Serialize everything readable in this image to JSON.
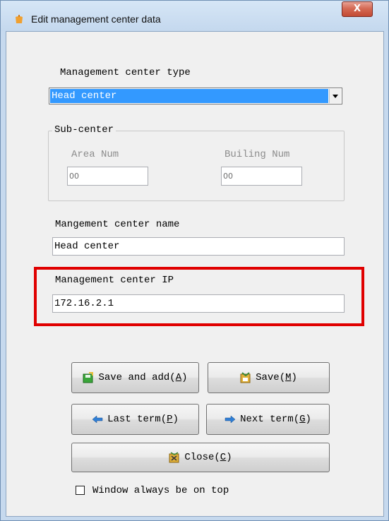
{
  "window": {
    "title": "Edit management center data",
    "close_label": "X"
  },
  "type_section": {
    "label": "Management center type",
    "selected": "Head center"
  },
  "sub_center": {
    "legend": "Sub-center",
    "area_label": "Area Num",
    "area_value": "00",
    "building_label": "Builing Num",
    "building_value": "00"
  },
  "name_section": {
    "label": "Mangement center name",
    "value": "Head center"
  },
  "ip_section": {
    "label": "Management center IP",
    "value": "172.16.2.1"
  },
  "buttons": {
    "save_add": "Save and add",
    "save_add_key": "A",
    "save": "Save",
    "save_key": "M",
    "last": "Last term",
    "last_key": "P",
    "next": "Next term",
    "next_key": "G",
    "close": "Close",
    "close_key": "C"
  },
  "always_on_top": {
    "label": "Window always be on top",
    "checked": false
  },
  "colors": {
    "highlight": "#e00000",
    "selection": "#3399ff",
    "accent_icon": "#f0a030"
  }
}
